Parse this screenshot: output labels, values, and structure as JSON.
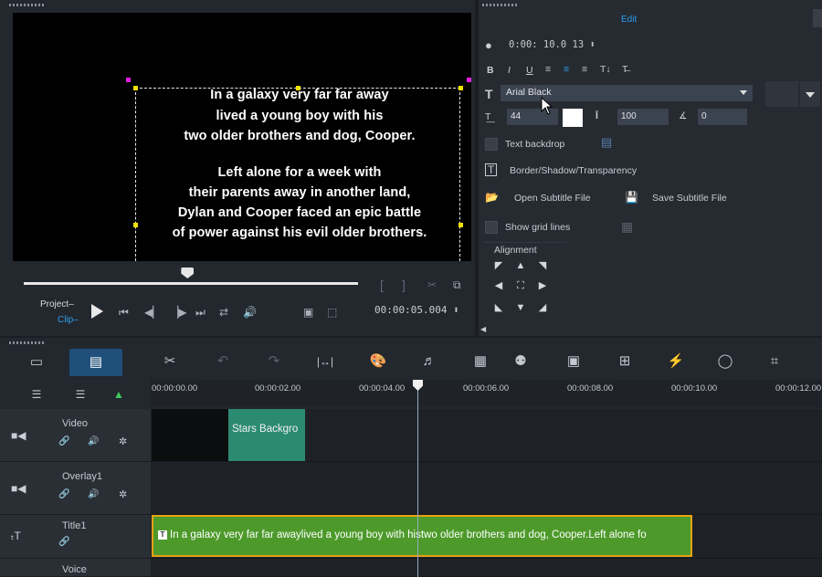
{
  "preview": {
    "subtitle_lines": [
      "In a galaxy very far far away",
      "lived a young boy with his",
      "two older brothers and dog, Cooper.",
      "",
      "Left alone for a week with",
      "their parents away in another land,",
      "Dylan and Cooper faced an epic battle",
      "of power against his evil older brothers."
    ],
    "project_label": "Project",
    "clip_label": "Clip",
    "timecode": "00:00:05.004",
    "scrub_progress": 0.49
  },
  "options": {
    "tab_label": "Edit",
    "duration": "0:00: 10.0 13",
    "font_name": "Arial Black",
    "font_size": "44",
    "line_spacing": "100",
    "rotation": "0",
    "text_backdrop_label": "Text backdrop",
    "border_label": "Border/Shadow/Transparency",
    "open_subtitle_label": "Open Subtitle File",
    "save_subtitle_label": "Save Subtitle File",
    "grid_lines_label": "Show grid lines",
    "alignment_label": "Alignment",
    "format_buttons": [
      "B",
      "I",
      "U"
    ],
    "text_color": "#ffffff"
  },
  "timeline": {
    "ruler_labels": [
      "00:00:00.00",
      "00:00:02.00",
      "00:00:04.00",
      "00:00:06.00",
      "00:00:08.00",
      "00:00:10.00",
      "00:00:12.00"
    ],
    "tracks": [
      {
        "name": "Video"
      },
      {
        "name": "Overlay1"
      },
      {
        "name": "Title1"
      },
      {
        "name": "Voice"
      }
    ],
    "video_clip_label": "Stars Backgro",
    "title_clip_text": "In a galaxy very far far awaylived a young boy with histwo older brothers and dog, Cooper.Left alone fo"
  },
  "colors": {
    "accent": "#2d9df0",
    "video_clip": "#2b8b72",
    "title_clip": "#4d9a2b",
    "clip_border": "#e8a014"
  }
}
